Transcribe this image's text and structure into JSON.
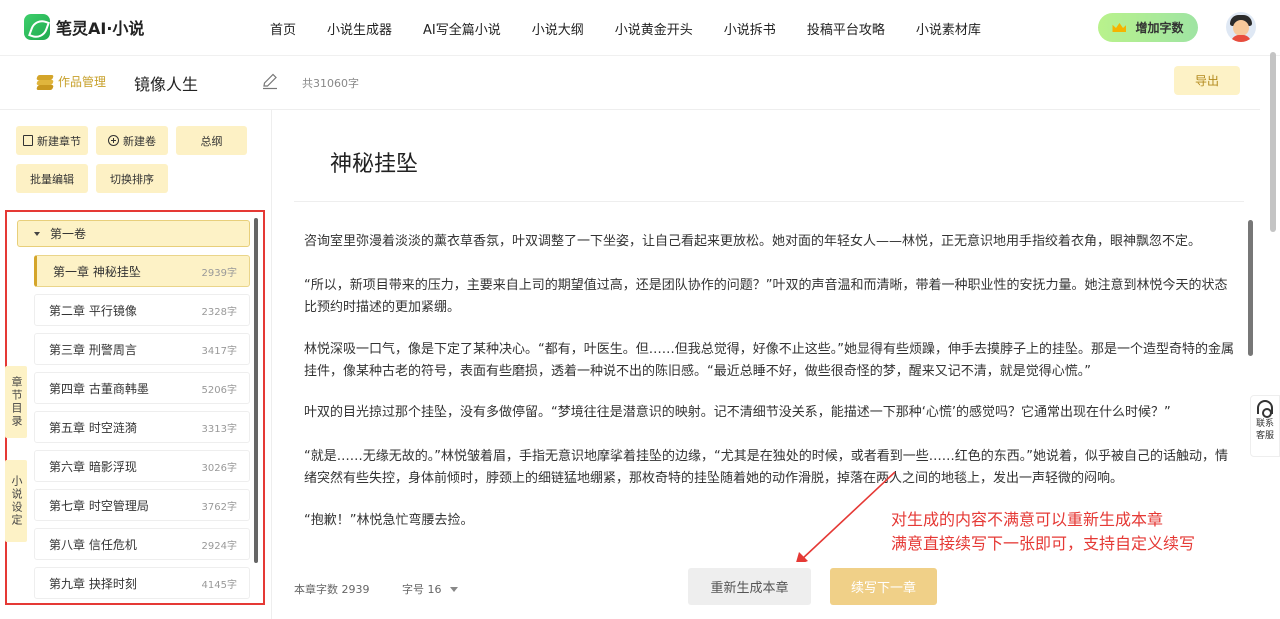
{
  "app": {
    "name": "笔灵AI·小说"
  },
  "nav": {
    "links": [
      "首页",
      "小说生成器",
      "AI写全篇小说",
      "小说大纲",
      "小说黄金开头",
      "小说拆书",
      "投稿平台攻略",
      "小说素材库"
    ],
    "add_words": "增加字数"
  },
  "work": {
    "mgmt_label": "作品管理",
    "title": "镜像人生",
    "word_total": "共31060字",
    "export": "导出"
  },
  "tools": {
    "new_chapter": "新建章节",
    "new_volume": "新建卷",
    "outline": "总纲",
    "batch_edit": "批量编辑",
    "sort": "切换排序"
  },
  "side_tabs": {
    "catalog": "章节目录",
    "settings": "小说设定"
  },
  "volume": {
    "name": "第一卷"
  },
  "chapters": [
    {
      "name": "第一章 神秘挂坠",
      "words": "2939字"
    },
    {
      "name": "第二章 平行镜像",
      "words": "2328字"
    },
    {
      "name": "第三章 刑警周言",
      "words": "3417字"
    },
    {
      "name": "第四章 古董商韩墨",
      "words": "5206字"
    },
    {
      "name": "第五章 时空涟漪",
      "words": "3313字"
    },
    {
      "name": "第六章 暗影浮现",
      "words": "3026字"
    },
    {
      "name": "第七章 时空管理局",
      "words": "3762字"
    },
    {
      "name": "第八章 信任危机",
      "words": "2924字"
    },
    {
      "name": "第九章 抉择时刻",
      "words": "4145字"
    }
  ],
  "editor": {
    "title": "神秘挂坠",
    "paragraphs": [
      "咨询室里弥漫着淡淡的薰衣草香氛，叶双调整了一下坐姿，让自己看起来更放松。她对面的年轻女人——林悦，正无意识地用手指绞着衣角，眼神飘忽不定。",
      "“所以，新项目带来的压力，主要来自上司的期望值过高，还是团队协作的问题？”叶双的声音温和而清晰，带着一种职业性的安抚力量。她注意到林悦今天的状态比预约时描述的更加紧绷。",
      "林悦深吸一口气，像是下定了某种决心。“都有，叶医生。但……但我总觉得，好像不止这些。”她显得有些烦躁，伸手去摸脖子上的挂坠。那是一个造型奇特的金属挂件，像某种古老的符号，表面有些磨损，透着一种说不出的陈旧感。“最近总睡不好，做些很奇怪的梦，醒来又记不清，就是觉得心慌。”",
      "叶双的目光掠过那个挂坠，没有多做停留。“梦境往往是潜意识的映射。记不清细节没关系，能描述一下那种‘心慌’的感觉吗？它通常出现在什么时候？”",
      "“就是……无缘无故的。”林悦皱着眉，手指无意识地摩挲着挂坠的边缘，“尤其是在独处的时候，或者看到一些……红色的东西。”她说着，似乎被自己的话触动，情绪突然有些失控，身体前倾时，脖颈上的细链猛地绷紧，那枚奇特的挂坠随着她的动作滑脱，掉落在两人之间的地毯上，发出一声轻微的闷响。",
      "“抱歉！”林悦急忙弯腰去捡。"
    ],
    "annotation": [
      "对生成的内容不满意可以重新生成本章",
      "满意直接续写下一张即可，支持自定义续写"
    ],
    "chapter_word_count": "本章字数 2939",
    "font_size": "字号 16",
    "regen": "重新生成本章",
    "continue": "续写下一章"
  },
  "support": {
    "label": "联系客服"
  },
  "colors": {
    "accent": "#d4a52a",
    "highlight_box": "#e53935",
    "brand_green": "#1fa94f"
  }
}
